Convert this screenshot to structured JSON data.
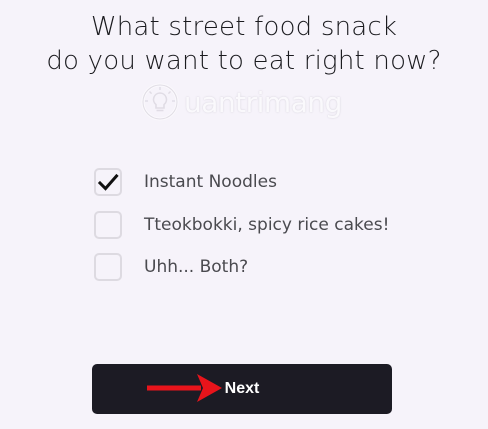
{
  "question": {
    "line1": "What street food snack",
    "line2": "do you want to eat right now?"
  },
  "watermark": {
    "text": "uantrimang",
    "icon": "lightbulb-icon"
  },
  "options": [
    {
      "label": "Instant Noodles",
      "checked": true
    },
    {
      "label": "Tteokbokki, spicy rice cakes!",
      "checked": false
    },
    {
      "label": "Uhh... Both?",
      "checked": false
    }
  ],
  "next_button": {
    "label": "Next"
  },
  "annotation": {
    "icon": "red-arrow-icon",
    "color": "#e8141b"
  },
  "colors": {
    "background": "#f6f3fa",
    "button": "#1c1b24",
    "checkbox_border": "#dddae1",
    "check": "#111111"
  }
}
